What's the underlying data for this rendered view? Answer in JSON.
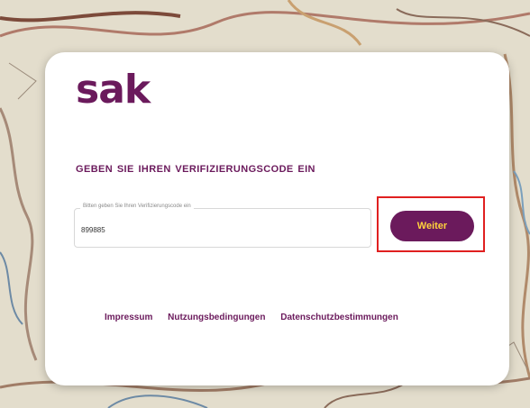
{
  "logo": {
    "text": "sak"
  },
  "heading": "Geben Sie Ihren Verifizierungscode ein",
  "code_field": {
    "label": "Bitten geben Sie Ihren Verifizierungscode ein",
    "value": "899885"
  },
  "continue_button": {
    "label": "Weiter"
  },
  "footer": {
    "links": [
      "Impressum",
      "Nutzungsbedingungen",
      "Datenschutzbestimmungen"
    ]
  },
  "colors": {
    "brand": "#6b1a5c",
    "button_text": "#ffd23c",
    "highlight": "#e02020"
  }
}
